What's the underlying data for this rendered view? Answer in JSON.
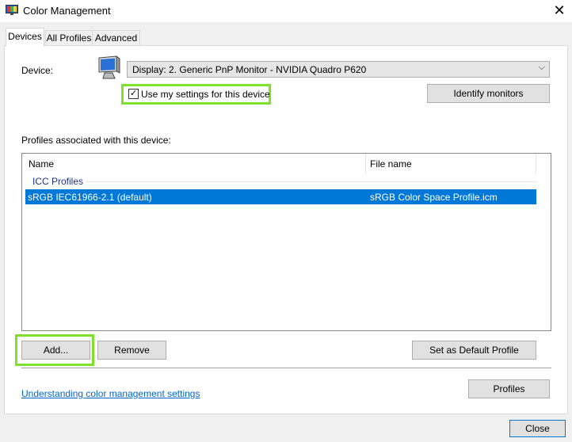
{
  "window": {
    "title": "Color Management",
    "close_glyph": "✕",
    "app_icon": "color-management-icon"
  },
  "tabs": [
    {
      "label": "Devices",
      "active": true
    },
    {
      "label": "All Profiles",
      "active": false
    },
    {
      "label": "Advanced",
      "active": false
    }
  ],
  "device": {
    "label": "Device:",
    "icon": "monitor-icon",
    "selected": "Display: 2. Generic PnP Monitor - NVIDIA Quadro P620",
    "chevron": "⌵",
    "use_settings_label": "Use my settings for this device",
    "use_settings_checked": true,
    "check_glyph": "✓",
    "identify_button": "Identify monitors"
  },
  "profiles": {
    "label": "Profiles associated with this device:",
    "columns": [
      "Name",
      "File name"
    ],
    "group": "ICC Profiles",
    "rows": [
      {
        "name": "sRGB IEC61966-2.1 (default)",
        "file": "sRGB Color Space Profile.icm",
        "selected": true
      }
    ]
  },
  "buttons": {
    "add": "Add...",
    "remove": "Remove",
    "set_default": "Set as Default Profile",
    "profiles": "Profiles",
    "close": "Close"
  },
  "link": "Understanding color management settings",
  "colors": {
    "highlight": "#7ee12b",
    "selection": "#0078d7",
    "link": "#0066cc"
  }
}
